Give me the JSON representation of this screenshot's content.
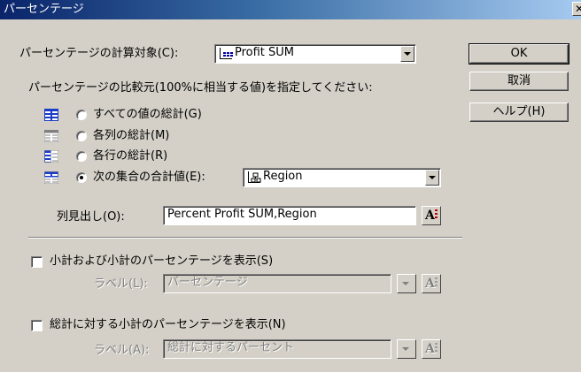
{
  "window": {
    "title": "パーセンテージ",
    "close_glyph": "✕"
  },
  "calc_target": {
    "label": "パーセンテージの計算対象(C):",
    "value": "Profit SUM",
    "icon": "measure-icon"
  },
  "buttons": {
    "ok": "OK",
    "cancel": "取消",
    "help": "ヘルプ(H)"
  },
  "base_section": {
    "instruction": "パーセンテージの比較元(100%に相当する値)を指定してください:",
    "options": [
      {
        "label": "すべての値の総計(G)",
        "checked": false,
        "icon": "grand-total-grid-icon"
      },
      {
        "label": "各列の総計(M)",
        "checked": false,
        "icon": "column-total-grid-icon"
      },
      {
        "label": "各行の総計(R)",
        "checked": false,
        "icon": "row-total-grid-icon"
      },
      {
        "label": "次の集合の合計値(E):",
        "checked": true,
        "icon": "set-total-grid-icon"
      }
    ],
    "set_value": "Region",
    "set_icon": "hierarchy-icon"
  },
  "column_header": {
    "label": "列見出し(O):",
    "value": "Percent Profit SUM,Region",
    "font_button": "A"
  },
  "subtotal": {
    "checkbox_label": "小計および小計のパーセンテージを表示(S)",
    "checked": false,
    "label_caption": "ラベル(L):",
    "label_placeholder": "パーセンテージ"
  },
  "total": {
    "checkbox_label": "総計に対する小計のパーセンテージを表示(N)",
    "checked": false,
    "label_caption": "ラベル(A):",
    "label_placeholder": "総計に対するパーセント"
  },
  "colors": {
    "dialog_bg": "#d4d0c8",
    "title_start": "#0a246a",
    "title_end": "#a6caf0",
    "disabled_text": "#808080"
  }
}
